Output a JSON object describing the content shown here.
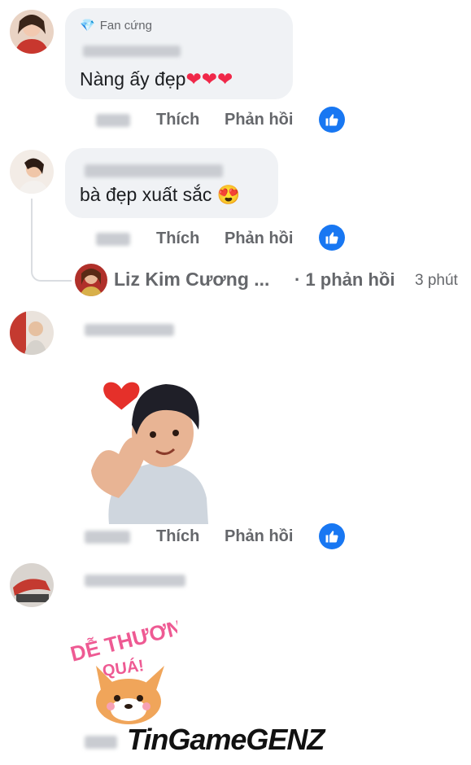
{
  "comments": [
    {
      "badge": "Fan cứng",
      "text": "Nàng ấy đẹp",
      "hearts": "❤❤❤",
      "actions": {
        "like": "Thích",
        "reply": "Phản hồi"
      }
    },
    {
      "text": "bà đẹp xuất sắc",
      "emoji": "😍",
      "actions": {
        "like": "Thích",
        "reply": "Phản hồi"
      },
      "reply_preview": {
        "name": "Liz Kim Cương ...",
        "count": "· 1 phản hồi",
        "time": "3 phút"
      }
    },
    {
      "actions": {
        "like": "Thích",
        "reply": "Phản hồi"
      }
    },
    {
      "sticker_text_1": "DỄ THƯƠNG",
      "sticker_text_2": "QUÁ!"
    }
  ],
  "watermark": "TinGameGENZ",
  "colors": {
    "like_blue": "#1877f2",
    "bubble": "#f0f2f5",
    "meta": "#65676b"
  }
}
